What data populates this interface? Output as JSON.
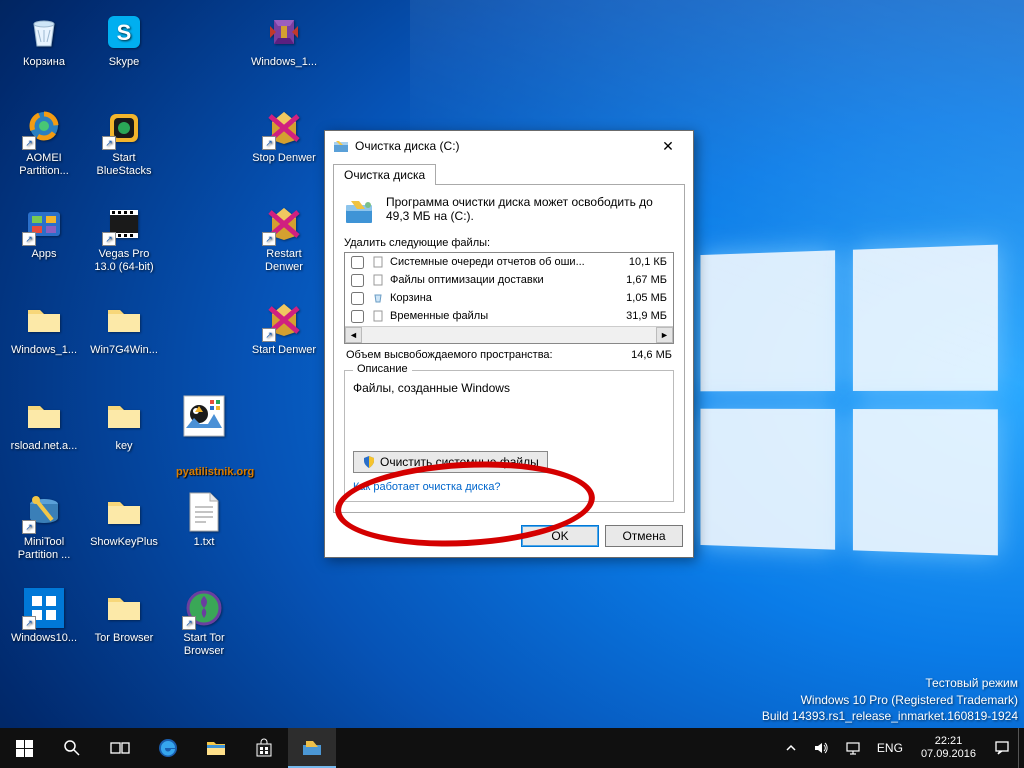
{
  "desktop": {
    "icons": [
      {
        "label": "Корзина",
        "icon": "recycle"
      },
      {
        "label": "Skype",
        "icon": "skype"
      },
      {
        "label": "",
        "icon": "empty"
      },
      {
        "label": "Windows_1...",
        "icon": "winrar"
      },
      {
        "label": "",
        "icon": "empty"
      },
      {
        "label": "AOMEI Partition...",
        "icon": "aomei",
        "shortcut": true
      },
      {
        "label": "Start BlueStacks",
        "icon": "bluestacks",
        "shortcut": true
      },
      {
        "label": "",
        "icon": "empty"
      },
      {
        "label": "Stop Denwer",
        "icon": "denwer-stop",
        "shortcut": true
      },
      {
        "label": "",
        "icon": "empty"
      },
      {
        "label": "Apps",
        "icon": "apps",
        "shortcut": true
      },
      {
        "label": "Vegas Pro 13.0 (64-bit)",
        "icon": "vegas",
        "shortcut": true
      },
      {
        "label": "",
        "icon": "empty"
      },
      {
        "label": "Restart Denwer",
        "icon": "denwer-restart",
        "shortcut": true
      },
      {
        "label": "",
        "icon": "empty"
      },
      {
        "label": "Windows_1...",
        "icon": "folder"
      },
      {
        "label": "Win7G4Win...",
        "icon": "folder"
      },
      {
        "label": "",
        "icon": "empty"
      },
      {
        "label": "Start Denwer",
        "icon": "denwer-start",
        "shortcut": true
      },
      {
        "label": "",
        "icon": "empty"
      },
      {
        "label": "rsload.net.a...",
        "icon": "folder"
      },
      {
        "label": "key",
        "icon": "folder"
      },
      {
        "label": "",
        "icon": "image"
      },
      {
        "label": "",
        "icon": "empty"
      },
      {
        "label": "",
        "icon": "empty"
      },
      {
        "label": "MiniTool Partition ...",
        "icon": "minitool",
        "shortcut": true
      },
      {
        "label": "ShowKeyPlus",
        "icon": "folder"
      },
      {
        "label": "1.txt",
        "icon": "txt"
      },
      {
        "label": "",
        "icon": "empty"
      },
      {
        "label": "",
        "icon": "empty"
      },
      {
        "label": "Windows10...",
        "icon": "win10tile",
        "shortcut": true
      },
      {
        "label": "Tor Browser",
        "icon": "folder"
      },
      {
        "label": "Start Tor Browser",
        "icon": "tor",
        "shortcut": true
      },
      {
        "label": "",
        "icon": "empty"
      },
      {
        "label": "",
        "icon": "empty"
      }
    ]
  },
  "image_watermark": "pyatilistnik.org",
  "dialog": {
    "title": "Очистка диска  (C:)",
    "tab": "Очистка диска",
    "message": "Программа очистки диска может освободить до 49,3 МБ на  (C:).",
    "list_label": "Удалить следующие файлы:",
    "files": [
      {
        "name": "Системные очереди отчетов об оши...",
        "size": "10,1 КБ",
        "checked": false,
        "icon": "doc"
      },
      {
        "name": "Файлы оптимизации доставки",
        "size": "1,67 МБ",
        "checked": false,
        "icon": "doc"
      },
      {
        "name": "Корзина",
        "size": "1,05 МБ",
        "checked": false,
        "icon": "bin"
      },
      {
        "name": "Временные файлы",
        "size": "31,9 МБ",
        "checked": false,
        "icon": "doc"
      }
    ],
    "summary_label": "Объем высвобождаемого пространства:",
    "summary_value": "14,6 МБ",
    "desc_group": "Описание",
    "desc_text": "Файлы, созданные Windows",
    "sys_button": "Очистить системные файлы",
    "help_link": "Как работает очистка диска?",
    "ok": "OK",
    "cancel": "Отмена"
  },
  "watermark": {
    "l1": "Тестовый режим",
    "l2": "Windows 10 Pro (Registered Trademark)",
    "l3": "Build 14393.rs1_release_inmarket.160819-1924"
  },
  "taskbar": {
    "lang": "ENG",
    "time": "22:21",
    "date": "07.09.2016"
  }
}
